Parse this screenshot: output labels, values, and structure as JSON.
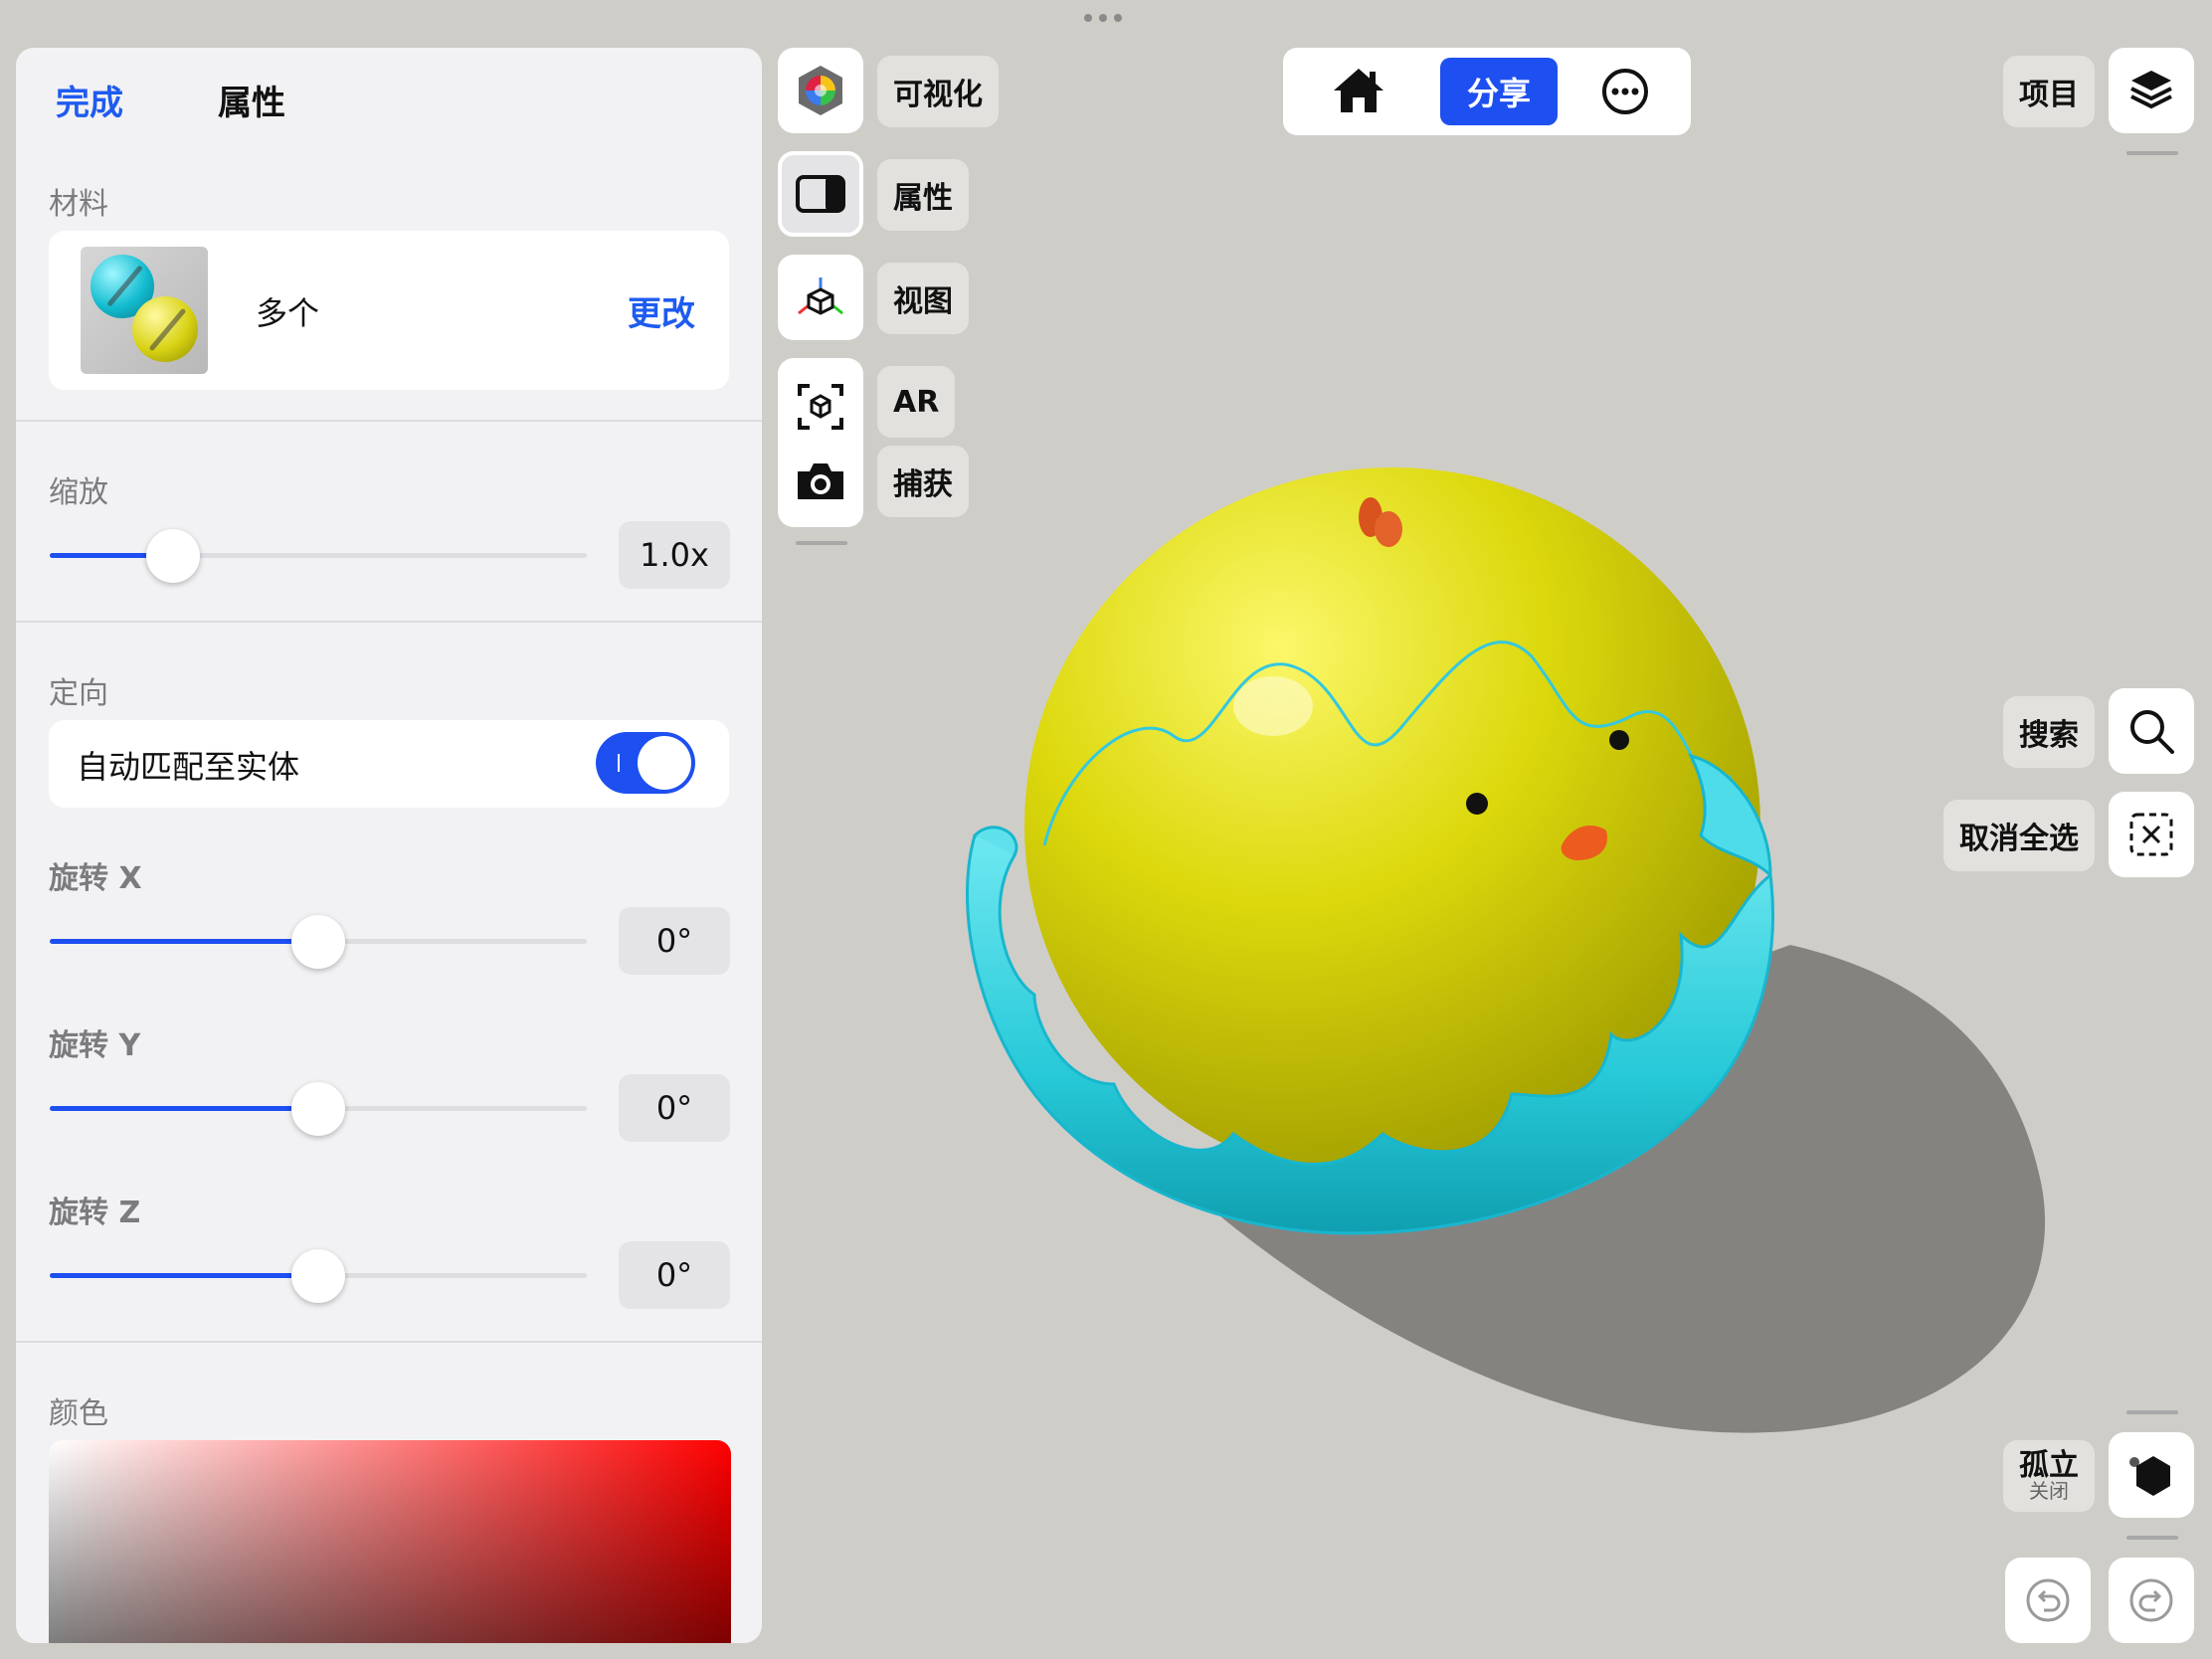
{
  "panel": {
    "done_label": "完成",
    "title": "属性",
    "material": {
      "section_label": "材料",
      "name": "多个",
      "change_label": "更改"
    },
    "scale": {
      "section_label": "缩放",
      "value": "1.0x",
      "slider_fraction": 0.23
    },
    "orientation": {
      "section_label": "定向",
      "auto_match_label": "自动匹配至实体",
      "auto_match_on": true
    },
    "rotation": [
      {
        "label": "旋转 X",
        "value": "0°",
        "slider_fraction": 0.5
      },
      {
        "label": "旋转 Y",
        "value": "0°",
        "slider_fraction": 0.5
      },
      {
        "label": "旋转 Z",
        "value": "0°",
        "slider_fraction": 0.5
      }
    ],
    "color": {
      "section_label": "颜色"
    }
  },
  "tools": {
    "visualize_label": "可视化",
    "properties_label": "属性",
    "view_label": "视图",
    "ar_label": "AR",
    "capture_label": "捕获"
  },
  "toolbar": {
    "share_label": "分享"
  },
  "right": {
    "project_label": "项目",
    "search_label": "搜索",
    "deselect_label": "取消全选",
    "isolate_label": "孤立",
    "isolate_state": "关闭"
  },
  "colors": {
    "accent": "#1e4ff0",
    "link": "#1e5bf0",
    "canvas_bg": "#cfcdc8",
    "model_yellow": "#d8d60a",
    "model_cyan": "#2fd0de"
  }
}
